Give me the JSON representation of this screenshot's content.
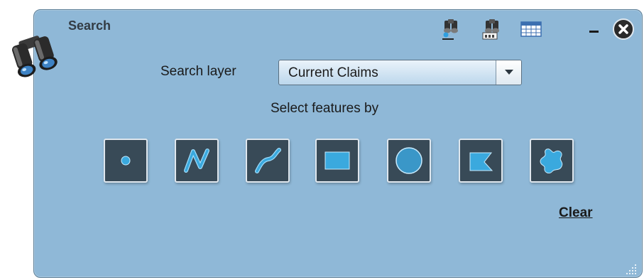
{
  "window": {
    "title": "Search",
    "icons": {
      "logo": "binoculars-icon",
      "tool_1": "binoculars-point-icon",
      "tool_2": "binoculars-text-icon",
      "tool_3": "table-icon",
      "minimize": "minimize-icon",
      "close": "close-icon"
    }
  },
  "form": {
    "search_layer_label": "Search layer",
    "search_layer_value": "Current Claims",
    "select_features_label": "Select features by"
  },
  "selection_tools": [
    {
      "name": "point",
      "icon": "point-icon"
    },
    {
      "name": "polyline",
      "icon": "polyline-icon"
    },
    {
      "name": "freehand-line",
      "icon": "freehand-line-icon"
    },
    {
      "name": "rectangle",
      "icon": "rectangle-icon"
    },
    {
      "name": "circle",
      "icon": "circle-icon"
    },
    {
      "name": "polygon",
      "icon": "polygon-icon"
    },
    {
      "name": "freehand-polygon",
      "icon": "freehand-polygon-icon"
    }
  ],
  "actions": {
    "clear_label": "Clear"
  },
  "colors": {
    "panel_bg": "#8fb8d7",
    "button_bg": "#384a57",
    "accent_blue": "#3aa9de"
  }
}
